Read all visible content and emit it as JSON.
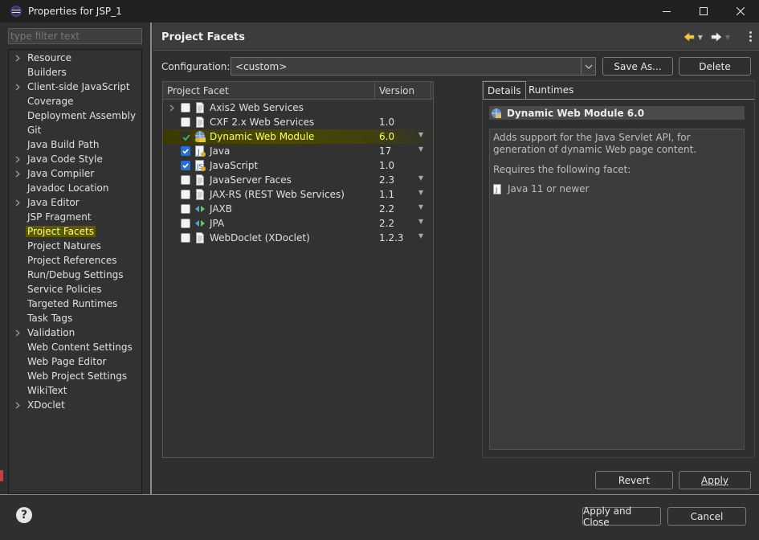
{
  "window": {
    "title": "Properties for JSP_1",
    "controls": {
      "minimize_icon": "minimize-icon",
      "maximize_icon": "maximize-icon",
      "close_icon": "close-icon"
    }
  },
  "filter": {
    "placeholder": "type filter text",
    "value": ""
  },
  "tree": {
    "items": [
      {
        "label": "Resource",
        "expandable": true
      },
      {
        "label": "Builders",
        "expandable": false
      },
      {
        "label": "Client-side JavaScript",
        "expandable": true
      },
      {
        "label": "Coverage",
        "expandable": false
      },
      {
        "label": "Deployment Assembly",
        "expandable": false
      },
      {
        "label": "Git",
        "expandable": false
      },
      {
        "label": "Java Build Path",
        "expandable": false
      },
      {
        "label": "Java Code Style",
        "expandable": true
      },
      {
        "label": "Java Compiler",
        "expandable": true
      },
      {
        "label": "Javadoc Location",
        "expandable": false
      },
      {
        "label": "Java Editor",
        "expandable": true
      },
      {
        "label": "JSP Fragment",
        "expandable": false
      },
      {
        "label": "Project Facets",
        "expandable": false,
        "selected": true
      },
      {
        "label": "Project Natures",
        "expandable": false
      },
      {
        "label": "Project References",
        "expandable": false
      },
      {
        "label": "Run/Debug Settings",
        "expandable": false
      },
      {
        "label": "Service Policies",
        "expandable": false
      },
      {
        "label": "Targeted Runtimes",
        "expandable": false
      },
      {
        "label": "Task Tags",
        "expandable": false
      },
      {
        "label": "Validation",
        "expandable": true
      },
      {
        "label": "Web Content Settings",
        "expandable": false
      },
      {
        "label": "Web Page Editor",
        "expandable": false
      },
      {
        "label": "Web Project Settings",
        "expandable": false
      },
      {
        "label": "WikiText",
        "expandable": false
      },
      {
        "label": "XDoclet",
        "expandable": true
      }
    ]
  },
  "page": {
    "title": "Project Facets",
    "configuration_label": "Configuration:",
    "configuration_value": "<custom>",
    "save_as_label": "Save As...",
    "delete_label": "Delete",
    "table": {
      "headers": {
        "facet": "Project Facet",
        "version": "Version"
      },
      "rows": [
        {
          "name": "Axis2 Web Services",
          "version": "",
          "state": "unchecked",
          "expandable": true,
          "icon": "page-icon",
          "has_version_dropdown": false
        },
        {
          "name": "CXF 2.x Web Services",
          "version": "1.0",
          "state": "unchecked",
          "expandable": false,
          "icon": "page-icon",
          "has_version_dropdown": false
        },
        {
          "name": "Dynamic Web Module",
          "version": "6.0",
          "state": "locked",
          "expandable": false,
          "icon": "web-module-icon",
          "has_version_dropdown": true,
          "highlighted": true
        },
        {
          "name": "Java",
          "version": "17",
          "state": "checked",
          "expandable": false,
          "icon": "java-icon",
          "has_version_dropdown": true
        },
        {
          "name": "JavaScript",
          "version": "1.0",
          "state": "checked",
          "expandable": false,
          "icon": "javascript-icon",
          "has_version_dropdown": false
        },
        {
          "name": "JavaServer Faces",
          "version": "2.3",
          "state": "unchecked",
          "expandable": false,
          "icon": "page-icon",
          "has_version_dropdown": true
        },
        {
          "name": "JAX-RS (REST Web Services)",
          "version": "1.1",
          "state": "unchecked",
          "expandable": false,
          "icon": "page-icon",
          "has_version_dropdown": true
        },
        {
          "name": "JAXB",
          "version": "2.2",
          "state": "unchecked",
          "expandable": false,
          "icon": "jaxb-icon",
          "has_version_dropdown": true
        },
        {
          "name": "JPA",
          "version": "2.2",
          "state": "unchecked",
          "expandable": false,
          "icon": "jpa-icon",
          "has_version_dropdown": true
        },
        {
          "name": "WebDoclet (XDoclet)",
          "version": "1.2.3",
          "state": "unchecked",
          "expandable": false,
          "icon": "page-icon",
          "has_version_dropdown": true
        }
      ]
    },
    "details": {
      "tabs": [
        "Details",
        "Runtimes"
      ],
      "module_title": "Dynamic Web Module 6.0",
      "description": "Adds support for the Java Servlet API, for generation of dynamic Web page content.",
      "requires_label": "Requires the following facet:",
      "requirement": "Java 11 or newer"
    },
    "revert_label": "Revert",
    "apply_label": "Apply"
  },
  "footer": {
    "help_glyph": "?",
    "apply_close_label": "Apply and Close",
    "cancel_label": "Cancel"
  },
  "colors": {
    "background": "#2f2f2f",
    "highlight": "#ffff60",
    "selection_bg": "#5a5a00",
    "checkbox_blue": "#2a6fd0"
  }
}
